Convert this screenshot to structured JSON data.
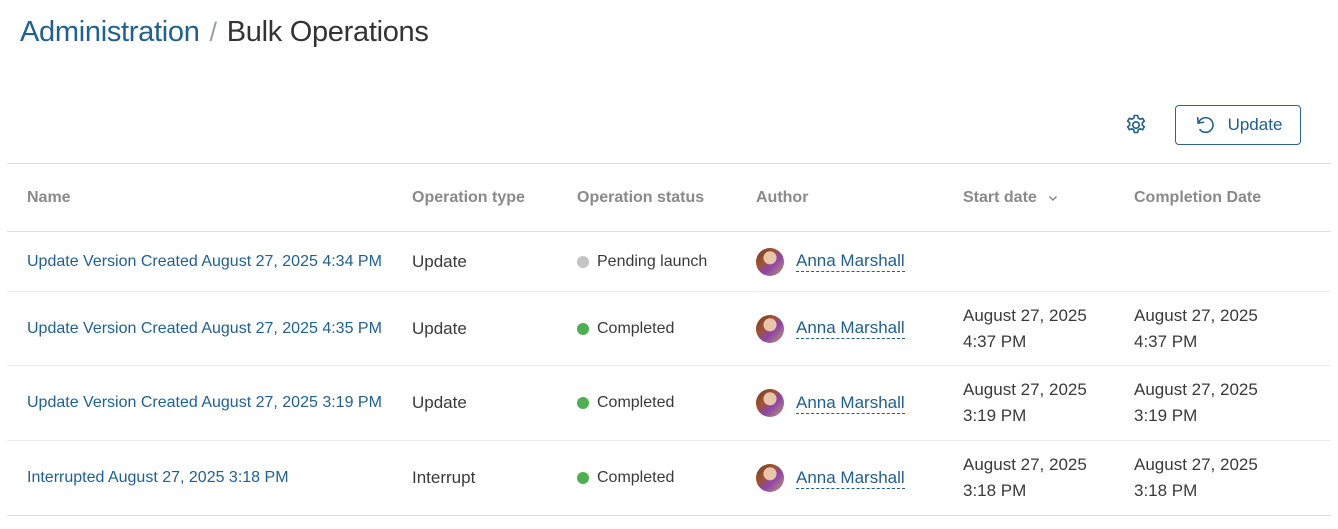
{
  "breadcrumb": {
    "parent": "Administration",
    "separator": "/",
    "current": "Bulk Operations"
  },
  "toolbar": {
    "settings_icon": "gear-icon",
    "update_label": "Update",
    "update_icon": "refresh-icon"
  },
  "table": {
    "columns": {
      "name": "Name",
      "type": "Operation type",
      "status": "Operation status",
      "author": "Author",
      "start": "Start date",
      "end": "Completion Date"
    },
    "sort_icon": "chevron-down-icon",
    "rows": [
      {
        "name": "Update Version Created August 27, 2025 4:34 PM",
        "type": "Update",
        "status": "Pending launch",
        "status_color": "#c4c4c4",
        "author": "Anna Marshall",
        "start_date": "",
        "start_time": "",
        "end_date": "",
        "end_time": ""
      },
      {
        "name": "Update Version Created August 27, 2025 4:35 PM",
        "type": "Update",
        "status": "Completed",
        "status_color": "#4caf50",
        "author": "Anna Marshall",
        "start_date": "August 27, 2025",
        "start_time": "4:37 PM",
        "end_date": "August 27, 2025",
        "end_time": "4:37 PM"
      },
      {
        "name": "Update Version Created August 27, 2025 3:19 PM",
        "type": "Update",
        "status": "Completed",
        "status_color": "#4caf50",
        "author": "Anna Marshall",
        "start_date": "August 27, 2025",
        "start_time": "3:19 PM",
        "end_date": "August 27, 2025",
        "end_time": "3:19 PM"
      },
      {
        "name": "Interrupted August 27, 2025 3:18 PM",
        "type": "Interrupt",
        "status": "Completed",
        "status_color": "#4caf50",
        "author": "Anna Marshall",
        "start_date": "August 27, 2025",
        "start_time": "3:18 PM",
        "end_date": "August 27, 2025",
        "end_time": "3:18 PM"
      }
    ]
  }
}
